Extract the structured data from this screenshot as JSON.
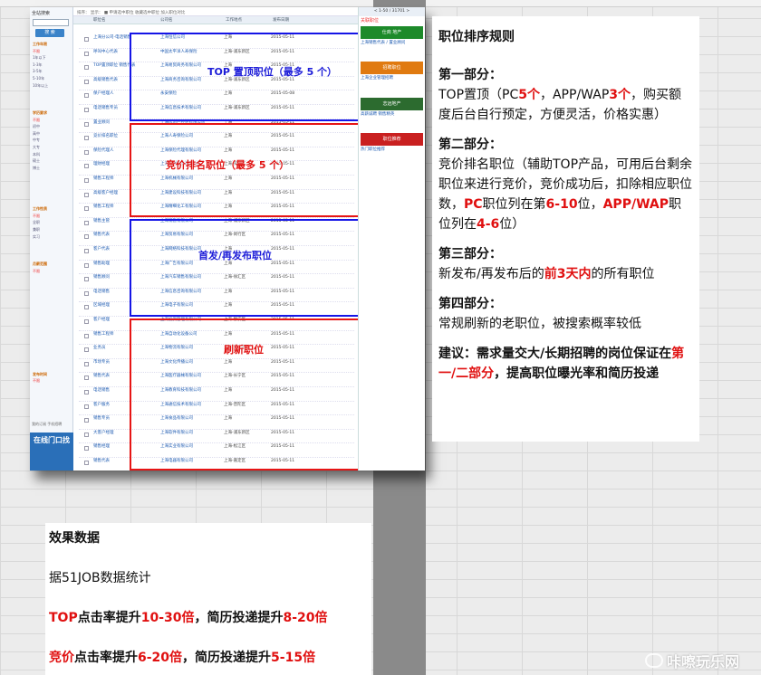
{
  "sidebar": {
    "title": "全站搜索",
    "button_label": "搜 索",
    "items": [
      {
        "label": "工作年限",
        "kind": "hdr"
      },
      {
        "label": "不限",
        "kind": "hot"
      },
      {
        "label": "1年以下",
        "kind": "n"
      },
      {
        "label": "1-3年",
        "kind": "n"
      },
      {
        "label": "3-5年",
        "kind": "n"
      },
      {
        "label": "5-10年",
        "kind": "n"
      },
      {
        "label": "10年以上",
        "kind": "n"
      },
      {
        "label": "",
        "kind": "n"
      },
      {
        "label": "",
        "kind": "n"
      },
      {
        "label": "",
        "kind": "n"
      },
      {
        "label": "学历要求",
        "kind": "hdr"
      },
      {
        "label": "不限",
        "kind": "hot"
      },
      {
        "label": "初中",
        "kind": "n"
      },
      {
        "label": "高中",
        "kind": "n"
      },
      {
        "label": "中专",
        "kind": "n"
      },
      {
        "label": "大专",
        "kind": "n"
      },
      {
        "label": "本科",
        "kind": "n"
      },
      {
        "label": "硕士",
        "kind": "n"
      },
      {
        "label": "博士",
        "kind": "n"
      },
      {
        "label": "",
        "kind": "n"
      },
      {
        "label": "",
        "kind": "n"
      },
      {
        "label": "",
        "kind": "n"
      },
      {
        "label": "",
        "kind": "n"
      },
      {
        "label": "",
        "kind": "n"
      },
      {
        "label": "工作性质",
        "kind": "hdr"
      },
      {
        "label": "不限",
        "kind": "hot"
      },
      {
        "label": "全职",
        "kind": "n"
      },
      {
        "label": "兼职",
        "kind": "n"
      },
      {
        "label": "实习",
        "kind": "n"
      },
      {
        "label": "",
        "kind": "n"
      },
      {
        "label": "",
        "kind": "n"
      },
      {
        "label": "",
        "kind": "n"
      },
      {
        "label": "月薪范围",
        "kind": "hdr"
      },
      {
        "label": "不限",
        "kind": "hot"
      },
      {
        "label": "",
        "kind": "n"
      },
      {
        "label": "",
        "kind": "n"
      },
      {
        "label": "",
        "kind": "n"
      },
      {
        "label": "",
        "kind": "n"
      },
      {
        "label": "",
        "kind": "n"
      },
      {
        "label": "",
        "kind": "n"
      },
      {
        "label": "",
        "kind": "n"
      },
      {
        "label": "",
        "kind": "n"
      },
      {
        "label": "",
        "kind": "n"
      },
      {
        "label": "",
        "kind": "n"
      },
      {
        "label": "",
        "kind": "n"
      },
      {
        "label": "",
        "kind": "n"
      },
      {
        "label": "",
        "kind": "n"
      },
      {
        "label": "",
        "kind": "n"
      },
      {
        "label": "发布时间",
        "kind": "hdr"
      },
      {
        "label": "不限",
        "kind": "hot"
      },
      {
        "label": "",
        "kind": "n"
      },
      {
        "label": "",
        "kind": "n"
      },
      {
        "label": "",
        "kind": "n"
      }
    ],
    "blue_block": "在线门口找",
    "mini_links": "我的订阅  手机招聘"
  },
  "joblist": {
    "toolbar": "排序：  显示：  ■ 申请选中职位  收藏选中职位  加入职位对比",
    "headers": [
      "职位名",
      "公司名",
      "工作地点",
      "发布日期"
    ],
    "rows": [
      {
        "t": "上海分公司-电话销售",
        "c": "上海恒信公司",
        "l": "上海",
        "d": "2015-05-11"
      },
      {
        "t": "呼叫中心代表",
        "c": "中国太平洋人寿保险",
        "l": "上海-浦东新区",
        "d": "2015-05-11"
      },
      {
        "t": "TOP置顶职位 销售代表",
        "c": "上海易贸商务有限公司",
        "l": "上海",
        "d": "2015-05-11"
      },
      {
        "t": "高级销售代表",
        "c": "上海商务咨询有限公司",
        "l": "上海-浦东新区",
        "d": "2015-05-11"
      },
      {
        "t": "保户经理人",
        "c": "永安保险",
        "l": "上海",
        "d": "2015-05-08"
      },
      {
        "t": "电话销售专员",
        "c": "上海信息技术有限公司",
        "l": "上海-浦东新区",
        "d": "2015-05-11"
      },
      {
        "t": "置业顾问",
        "c": "上海房地产经纪有限公司",
        "l": "上海",
        "d": "2015-05-11"
      },
      {
        "t": "竞价排名职位",
        "c": "上海人寿保险公司",
        "l": "上海",
        "d": "2015-05-11"
      },
      {
        "t": "保险代理人",
        "c": "上海保险代理有限公司",
        "l": "上海",
        "d": "2015-05-11"
      },
      {
        "t": "理财经理",
        "c": "上海理财服务有限公司",
        "l": "上海-黄浦区",
        "d": "2015-05-11"
      },
      {
        "t": "销售工程师",
        "c": "上海机械有限公司",
        "l": "上海",
        "d": "2015-05-11"
      },
      {
        "t": "高级客户经理",
        "c": "上海建设科技有限公司",
        "l": "上海",
        "d": "2015-05-11"
      },
      {
        "t": "销售工程师",
        "c": "上海精细化工有限公司",
        "l": "上海",
        "d": "2015-05-11"
      },
      {
        "t": "销售主管",
        "c": "上海销售有限公司",
        "l": "上海-浦东新区",
        "d": "2015-05-11"
      },
      {
        "t": "销售代表",
        "c": "上海贸易有限公司",
        "l": "上海-闵行区",
        "d": "2015-05-11"
      },
      {
        "t": "客户代表",
        "c": "上海网络科技有限公司",
        "l": "上海",
        "d": "2015-05-11"
      },
      {
        "t": "销售助理",
        "c": "上海广告有限公司",
        "l": "上海",
        "d": "2015-05-11"
      },
      {
        "t": "销售顾问",
        "c": "上海汽车销售有限公司",
        "l": "上海-徐汇区",
        "d": "2015-05-11"
      },
      {
        "t": "电话销售",
        "c": "上海信息咨询有限公司",
        "l": "上海",
        "d": "2015-05-11"
      },
      {
        "t": "区域经理",
        "c": "上海电子有限公司",
        "l": "上海",
        "d": "2015-05-11"
      },
      {
        "t": "客户经理",
        "c": "上海投资管理有限公司",
        "l": "上海-静安区",
        "d": "2015-05-11"
      },
      {
        "t": "销售工程师",
        "c": "上海自动化设备公司",
        "l": "上海",
        "d": "2015-05-11"
      },
      {
        "t": "业务员",
        "c": "上海物流有限公司",
        "l": "上海-宝山区",
        "d": "2015-05-11"
      },
      {
        "t": "市场专员",
        "c": "上海文化传播公司",
        "l": "上海",
        "d": "2015-05-11"
      },
      {
        "t": "销售代表",
        "c": "上海医疗器械有限公司",
        "l": "上海-长宁区",
        "d": "2015-05-11"
      },
      {
        "t": "电话销售",
        "c": "上海教育科技有限公司",
        "l": "上海",
        "d": "2015-05-11"
      },
      {
        "t": "客户服务",
        "c": "上海通信技术有限公司",
        "l": "上海-普陀区",
        "d": "2015-05-11"
      },
      {
        "t": "销售专员",
        "c": "上海食品有限公司",
        "l": "上海",
        "d": "2015-05-11"
      },
      {
        "t": "大客户经理",
        "c": "上海软件有限公司",
        "l": "上海-浦东新区",
        "d": "2015-05-11"
      },
      {
        "t": "销售经理",
        "c": "上海实业有限公司",
        "l": "上海-松江区",
        "d": "2015-05-11"
      },
      {
        "t": "销售代表",
        "c": "上海电器有限公司",
        "l": "上海-嘉定区",
        "d": "2015-05-11"
      }
    ]
  },
  "boxes": [
    {
      "label": "TOP 置顶职位（最多 5 个）",
      "color": "blue"
    },
    {
      "label": "竞价排名职位（最多 5 个）",
      "color": "red"
    },
    {
      "label": "首发/再发布职位",
      "color": "blue"
    },
    {
      "label": "刷新职位",
      "color": "red"
    }
  ],
  "ads": {
    "pager": "< 1-50 / 31701 >",
    "title": "关联职位",
    "banner1": "仕商 地产",
    "banner2": "招聘职位",
    "banner3": "志远地产",
    "banner4": "职位推荐",
    "text1": "上海销售代表 / 置业顾问",
    "text2": "上海企业管理招聘",
    "text3": "高薪诚聘 销售精英",
    "text4": "热门职位推荐"
  },
  "rules": {
    "title": "职位排序规则",
    "p1_head": "第一部分：",
    "p1": [
      {
        "text": "TOP置顶（PC",
        "red": false
      },
      {
        "text": "5个",
        "red": true
      },
      {
        "text": "，APP/WAP",
        "red": false
      },
      {
        "text": "3个",
        "red": true
      },
      {
        "text": "，购买额度后台自行预定，方便灵活，价格实惠）",
        "red": false
      }
    ],
    "p2_head": "第二部分：",
    "p2": [
      {
        "text": "竞价排名职位（辅助TOP产品，可用后台剩余职位来进行竞价，竞价成功后，扣除相应职位数，",
        "red": false
      },
      {
        "text": "PC",
        "red": true
      },
      {
        "text": "职位列在第",
        "red": false
      },
      {
        "text": "6-10",
        "red": true
      },
      {
        "text": "位，",
        "red": false
      },
      {
        "text": "APP/WAP",
        "red": true
      },
      {
        "text": "职位列在",
        "red": false
      },
      {
        "text": "4-6",
        "red": true
      },
      {
        "text": "位）",
        "red": false
      }
    ],
    "p3_head": "第三部分：",
    "p3": [
      {
        "text": "新发布/再发布后的",
        "red": false
      },
      {
        "text": "前3天内",
        "red": true
      },
      {
        "text": "的所有职位",
        "red": false
      }
    ],
    "p4_head": "第四部分：",
    "p4": "常规刷新的老职位，被搜索概率较低",
    "advice": [
      {
        "text": "建议：需求量交大/长期招聘的岗位保证在",
        "red": false
      },
      {
        "text": "第一/二部分",
        "red": true
      },
      {
        "text": "，提高职位曝光率和简历投递",
        "red": false
      }
    ]
  },
  "effect": {
    "title": "效果数据",
    "source": "据51JOB数据统计",
    "line1": [
      {
        "text": "TOP",
        "red": true
      },
      {
        "text": "点击率提升",
        "red": false
      },
      {
        "text": "10-30倍",
        "red": true
      },
      {
        "text": "，简历投递提升",
        "red": false
      },
      {
        "text": "8-20倍",
        "red": true
      }
    ],
    "line2": [
      {
        "text": "竞价",
        "red": true
      },
      {
        "text": "点击率提升",
        "red": false
      },
      {
        "text": "6-20倍",
        "red": true
      },
      {
        "text": "，简历投递提升",
        "red": false
      },
      {
        "text": "5-15倍",
        "red": true
      }
    ]
  },
  "watermark": "咔嚓玩乐网"
}
